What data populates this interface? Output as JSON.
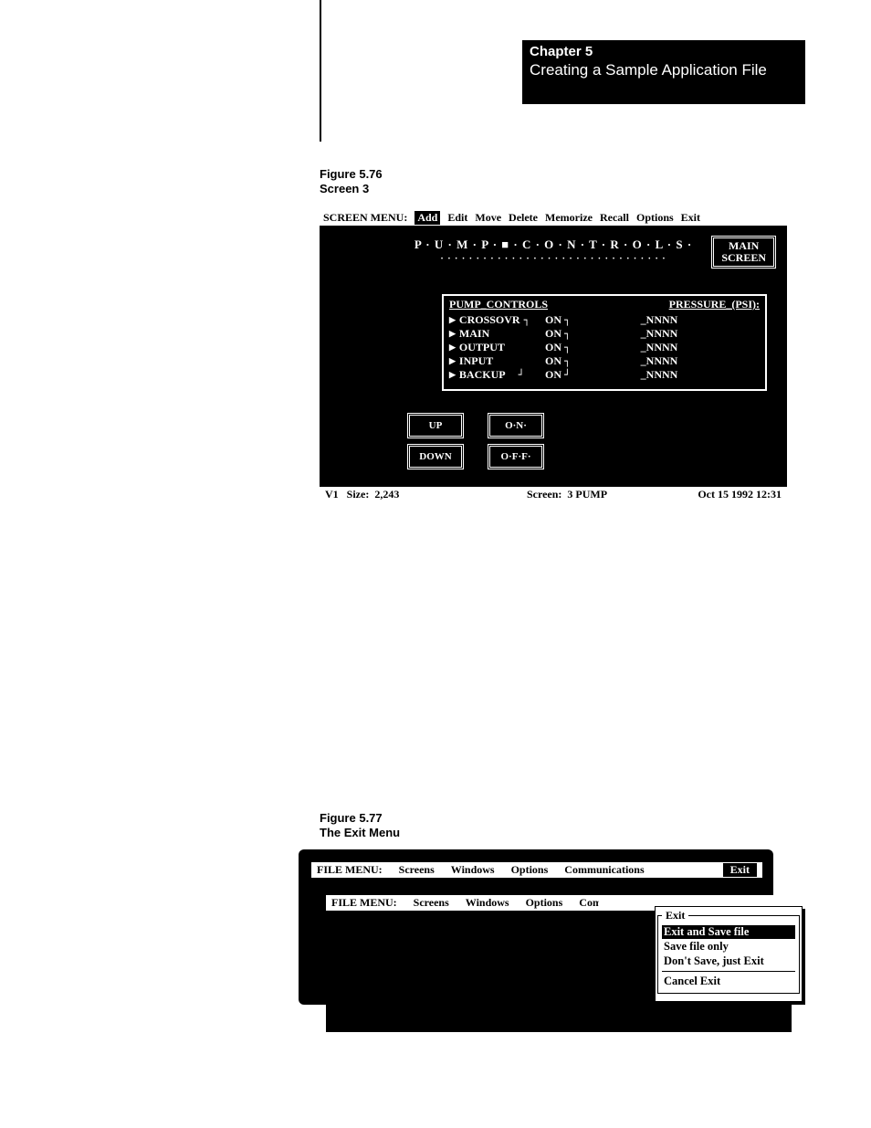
{
  "chapter": {
    "number": "Chapter 5",
    "title": "Creating a Sample Application File"
  },
  "figure76": {
    "label": "Figure 5.76",
    "caption": "Screen 3"
  },
  "figure77": {
    "label": "Figure 5.77",
    "caption": "The Exit Menu"
  },
  "screen1": {
    "menu_label": "SCREEN MENU:",
    "menu_items": [
      "Add",
      "Edit",
      "Move",
      "Delete",
      "Memorize",
      "Recall",
      "Options",
      "Exit"
    ],
    "selected_menu_index": 0,
    "main_button": {
      "line1": "MAIN",
      "line2": "SCREEN"
    },
    "title_spaced": "P · U · M · P · ■ · C · O · N · T · R · O · L · S ·",
    "title_dots": "· · · · · · · · · · · · · · · · · · · · · · · · · · · · · · · ·",
    "panel": {
      "header_left": "PUMP_CONTROLS",
      "header_right": "PRESSURE_(PSI):",
      "rows": [
        {
          "name": "CROSSOVR",
          "state": "ON",
          "pressure": "_NNNN"
        },
        {
          "name": "MAIN",
          "state": "ON",
          "pressure": "_NNNN"
        },
        {
          "name": "OUTPUT",
          "state": "ON",
          "pressure": "_NNNN"
        },
        {
          "name": "INPUT",
          "state": "ON",
          "pressure": "_NNNN"
        },
        {
          "name": "BACKUP",
          "state": "ON",
          "pressure": "_NNNN"
        }
      ]
    },
    "nav": {
      "up": "UP",
      "down": "DOWN",
      "on": "O·N·",
      "off": "O·F·F·"
    },
    "status": {
      "v": "V1",
      "size_label": "Size:",
      "size_value": "2,243",
      "screen_label": "Screen:",
      "screen_value": "3 PUMP",
      "timestamp": "Oct 15 1992 12:31"
    }
  },
  "screen2": {
    "menu_label": "FILE MENU:",
    "menu_items": [
      "Screens",
      "Windows",
      "Options",
      "Communications",
      "Exit"
    ],
    "exit_popup": {
      "title": "Exit",
      "options": [
        "Exit and Save file",
        "Save file only",
        "Don't Save, just Exit"
      ],
      "selected_index": 0,
      "cancel": "Cancel Exit"
    }
  }
}
